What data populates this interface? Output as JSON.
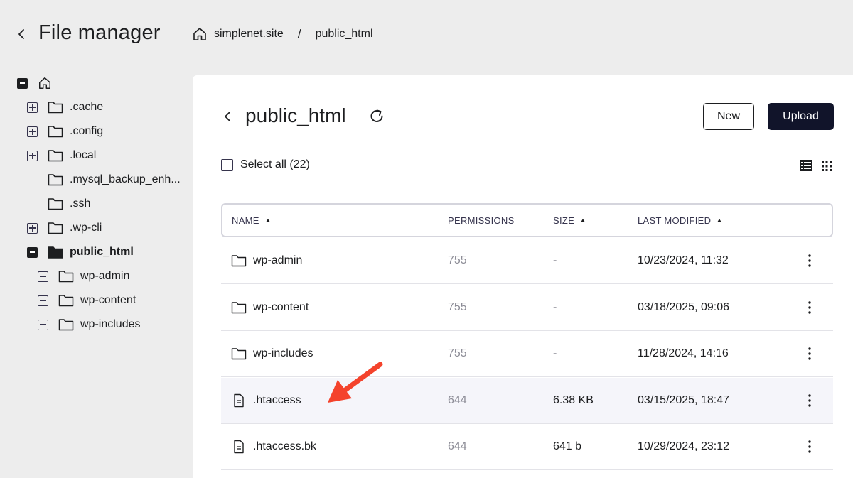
{
  "header": {
    "title": "File manager",
    "breadcrumb": [
      {
        "label": "simplenet.site"
      },
      {
        "label": "public_html"
      }
    ],
    "separator": "/"
  },
  "sidebar": {
    "items": [
      {
        "label": ".cache",
        "toggle": "plus"
      },
      {
        "label": ".config",
        "toggle": "plus"
      },
      {
        "label": ".local",
        "toggle": "plus"
      },
      {
        "label": ".mysql_backup_enh...",
        "toggle": "none"
      },
      {
        "label": ".ssh",
        "toggle": "none"
      },
      {
        "label": ".wp-cli",
        "toggle": "plus"
      },
      {
        "label": "public_html",
        "toggle": "minus",
        "active": true
      },
      {
        "label": "wp-admin",
        "toggle": "plus"
      },
      {
        "label": "wp-content",
        "toggle": "plus"
      },
      {
        "label": "wp-includes",
        "toggle": "plus"
      }
    ]
  },
  "main": {
    "title": "public_html",
    "new_label": "New",
    "upload_label": "Upload",
    "select_all_label": "Select all (22)",
    "columns": {
      "name": "NAME",
      "permissions": "PERMISSIONS",
      "size": "SIZE",
      "last_modified": "LAST MODIFIED"
    },
    "rows": [
      {
        "type": "folder",
        "name": "wp-admin",
        "permissions": "755",
        "size": "-",
        "modified": "10/23/2024, 11:32"
      },
      {
        "type": "folder",
        "name": "wp-content",
        "permissions": "755",
        "size": "-",
        "modified": "03/18/2025, 09:06"
      },
      {
        "type": "folder",
        "name": "wp-includes",
        "permissions": "755",
        "size": "-",
        "modified": "11/28/2024, 14:16"
      },
      {
        "type": "file",
        "name": ".htaccess",
        "permissions": "644",
        "size": "6.38 KB",
        "modified": "03/15/2025, 18:47",
        "highlighted": true
      },
      {
        "type": "file",
        "name": ".htaccess.bk",
        "permissions": "644",
        "size": "641 b",
        "modified": "10/29/2024, 23:12"
      }
    ]
  },
  "colors": {
    "primary_button": "#11142a",
    "annotation_arrow": "#f4432c",
    "row_highlight": "#f5f5fa"
  }
}
